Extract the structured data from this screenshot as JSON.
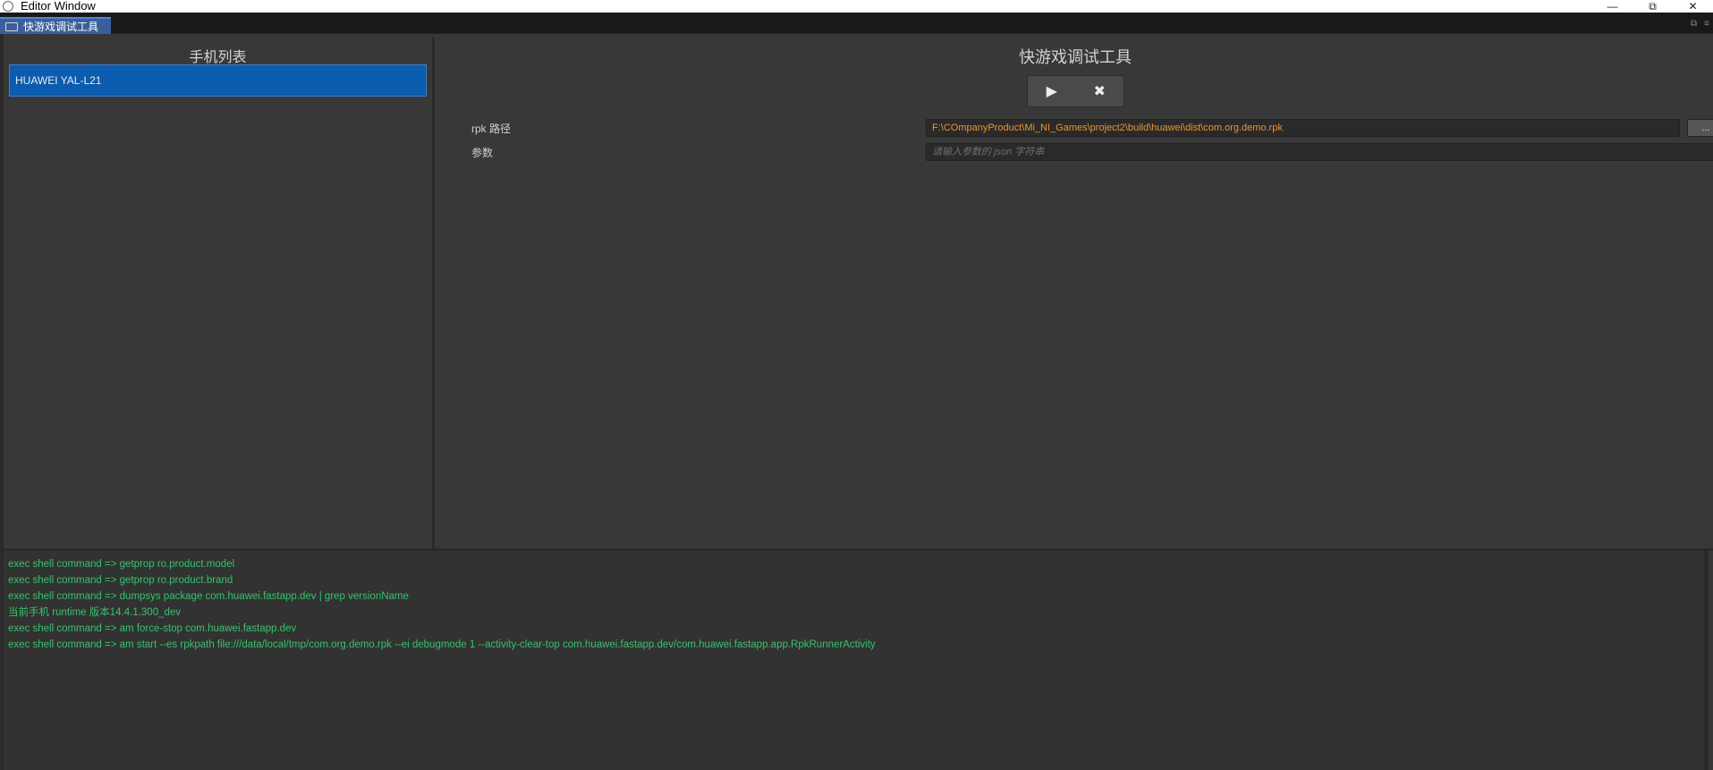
{
  "window": {
    "title": "Editor Window",
    "controls": {
      "minimize": "—",
      "restore": "⧉",
      "close": "✕"
    }
  },
  "tab": {
    "label": "快游戏调试工具",
    "icon": "monitor-icon"
  },
  "left_panel": {
    "header": "手机列表",
    "devices": [
      "HUAWEI YAL-L21"
    ],
    "selected_device": "HUAWEI YAL-L21"
  },
  "right_panel": {
    "title": "快游戏调试工具",
    "controls": {
      "play": "▶",
      "stop": "✖"
    },
    "rpk_path": {
      "label": "rpk 路径",
      "value": "F:\\COmpanyProduct\\Mi_NI_Games\\project2\\build\\huawei\\dist\\com.org.demo.rpk",
      "browse_label": "..."
    },
    "params": {
      "label": "参数",
      "placeholder": "请输入参数的 json 字符串",
      "value": ""
    }
  },
  "log": {
    "lines": [
      "exec shell command => getprop ro.product.model",
      "exec shell command => getprop ro.product.brand",
      "exec shell command => dumpsys package com.huawei.fastapp.dev | grep versionName",
      "当前手机 runtime 版本14.4.1.300_dev",
      "exec shell command => am force-stop com.huawei.fastapp.dev",
      "exec shell command => am start --es rpkpath file:///data/local/tmp/com.org.demo.rpk --ei debugmode 1 --activity-clear-top com.huawei.fastapp.dev/com.huawei.fastapp.app.RpkRunnerActivity"
    ]
  },
  "colors": {
    "accent": "#0b5bae",
    "path_text": "#f0922a",
    "log_text": "#37c26a",
    "background": "#383838"
  }
}
